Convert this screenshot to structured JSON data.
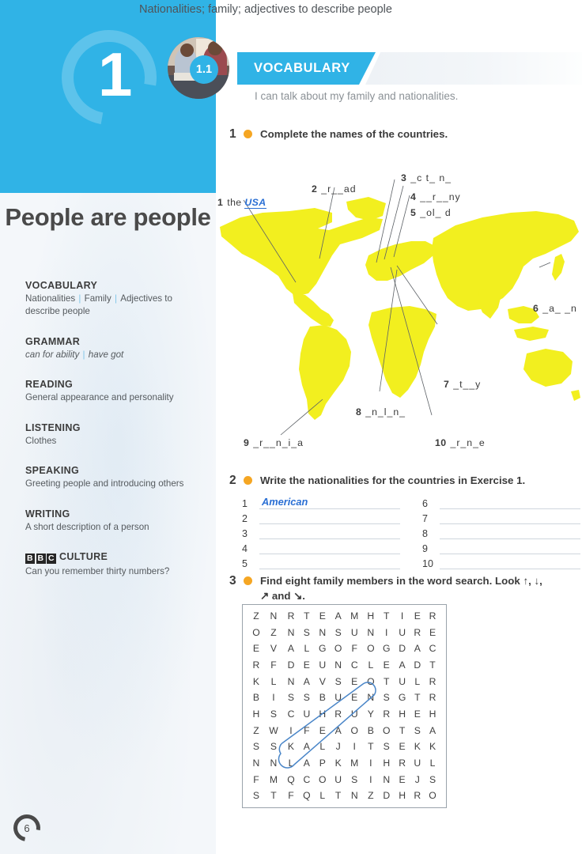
{
  "unit": {
    "number": "1",
    "lesson_badge": "1.1"
  },
  "header": {
    "section_label": "VOCABULARY",
    "topic": "Nationalities; family; adjectives to describe people",
    "can_do": "I can talk about my family and nationalities."
  },
  "book_title": "People are people",
  "contents": [
    {
      "heading": "VOCABULARY",
      "sub_parts": [
        "Nationalities",
        "Family",
        "Adjectives to describe people"
      ],
      "italic": false
    },
    {
      "heading": "GRAMMAR",
      "sub_parts": [
        "can for ability",
        "have got"
      ],
      "italic": true
    },
    {
      "heading": "READING",
      "sub_parts": [
        "General appearance and personality"
      ],
      "italic": false
    },
    {
      "heading": "LISTENING",
      "sub_parts": [
        "Clothes"
      ],
      "italic": false
    },
    {
      "heading": "SPEAKING",
      "sub_parts": [
        "Greeting people and introducing others"
      ],
      "italic": false
    },
    {
      "heading": "WRITING",
      "sub_parts": [
        "A short description of a person"
      ],
      "italic": false
    },
    {
      "heading": "CULTURE",
      "logo": "BBC",
      "sub_parts": [
        "Can you remember thirty numbers?"
      ],
      "italic": false
    }
  ],
  "page_number": "6",
  "exercise1": {
    "number": "1",
    "instruction": "Complete the names of the countries.",
    "map_labels": [
      {
        "n": "1",
        "prefix": "the ",
        "answer": "USA",
        "gapped": ""
      },
      {
        "n": "2",
        "prefix": "",
        "answer": "",
        "gapped": "_r__ad"
      },
      {
        "n": "3",
        "prefix": "",
        "answer": "",
        "gapped": "_c t_ n_"
      },
      {
        "n": "4",
        "prefix": "",
        "answer": "",
        "gapped": "__r__ny"
      },
      {
        "n": "5",
        "prefix": "",
        "answer": "",
        "gapped": "_ol_ d"
      },
      {
        "n": "6",
        "prefix": "",
        "answer": "",
        "gapped": "_a_ _n"
      },
      {
        "n": "7",
        "prefix": "",
        "answer": "",
        "gapped": "_t__y"
      },
      {
        "n": "8",
        "prefix": "",
        "answer": "",
        "gapped": "_n_l_n_"
      },
      {
        "n": "9",
        "prefix": "",
        "answer": "",
        "gapped": "_r__n_i_a"
      },
      {
        "n": "10",
        "prefix": "",
        "answer": "",
        "gapped": "_r_n_e"
      }
    ]
  },
  "exercise2": {
    "number": "2",
    "instruction": "Write the nationalities for the countries in Exercise 1.",
    "left_rows": [
      {
        "idx": "1",
        "value": "American"
      },
      {
        "idx": "2",
        "value": ""
      },
      {
        "idx": "3",
        "value": ""
      },
      {
        "idx": "4",
        "value": ""
      },
      {
        "idx": "5",
        "value": ""
      }
    ],
    "right_rows": [
      {
        "idx": "6",
        "value": ""
      },
      {
        "idx": "7",
        "value": ""
      },
      {
        "idx": "8",
        "value": ""
      },
      {
        "idx": "9",
        "value": ""
      },
      {
        "idx": "10",
        "value": ""
      }
    ]
  },
  "exercise3": {
    "number": "3",
    "instruction_line1": "Find eight family members in the word search. Look ↑, ↓,",
    "instruction_line2": "↗ and ↘.",
    "grid": [
      [
        "Z",
        "N",
        "R",
        "T",
        "E",
        "A",
        "M",
        "H",
        "T",
        "I",
        "E",
        "R"
      ],
      [
        "O",
        "Z",
        "N",
        "S",
        "N",
        "S",
        "U",
        "N",
        "I",
        "U",
        "R",
        "E"
      ],
      [
        "E",
        "V",
        "A",
        "L",
        "G",
        "O",
        "F",
        "O",
        "G",
        "D",
        "A",
        "C"
      ],
      [
        "R",
        "F",
        "D",
        "E",
        "U",
        "N",
        "C",
        "L",
        "E",
        "A",
        "D",
        "T"
      ],
      [
        "K",
        "L",
        "N",
        "A",
        "V",
        "S",
        "E",
        "O",
        "T",
        "U",
        "L",
        "R"
      ],
      [
        "B",
        "I",
        "S",
        "S",
        "B",
        "U",
        "E",
        "N",
        "S",
        "G",
        "T",
        "R"
      ],
      [
        "H",
        "S",
        "C",
        "U",
        "H",
        "R",
        "U",
        "Y",
        "R",
        "H",
        "E",
        "H"
      ],
      [
        "Z",
        "W",
        "I",
        "F",
        "E",
        "A",
        "O",
        "B",
        "O",
        "T",
        "S",
        "A"
      ],
      [
        "S",
        "S",
        "K",
        "A",
        "L",
        "J",
        "I",
        "T",
        "S",
        "E",
        "K",
        "K"
      ],
      [
        "N",
        "N",
        "L",
        "A",
        "P",
        "K",
        "M",
        "I",
        "H",
        "R",
        "U",
        "L"
      ],
      [
        "F",
        "M",
        "Q",
        "C",
        "O",
        "U",
        "S",
        "I",
        "N",
        "E",
        "J",
        "S"
      ],
      [
        "S",
        "T",
        "F",
        "Q",
        "L",
        "T",
        "N",
        "Z",
        "D",
        "H",
        "R",
        "O"
      ]
    ],
    "highlighted_word": "AUNT",
    "highlight_color": "#4a86c8"
  },
  "colors": {
    "brand_blue": "#30b3e6",
    "accent_orange": "#f5a623",
    "answer_blue": "#2a6fd4",
    "map_yellow": "#f2ef1f",
    "panel_grey": "#f4f7fa"
  }
}
